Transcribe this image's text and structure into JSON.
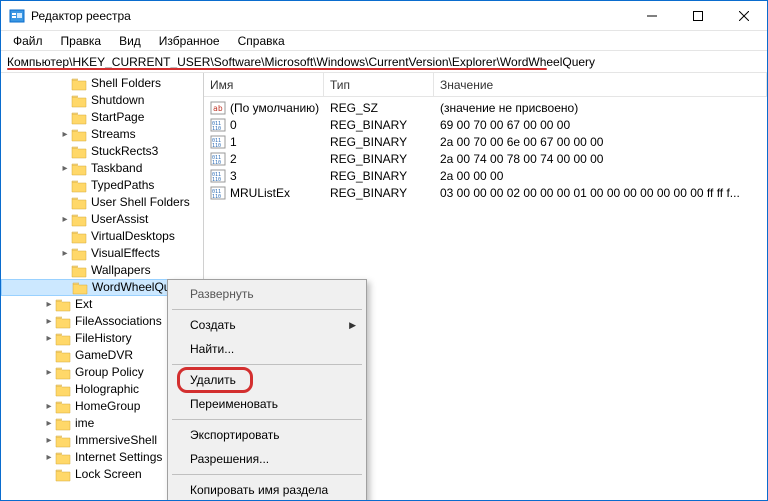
{
  "window": {
    "title": "Редактор реестра"
  },
  "menubar": [
    "Файл",
    "Правка",
    "Вид",
    "Избранное",
    "Справка"
  ],
  "address": "Компьютер\\HKEY_CURRENT_USER\\Software\\Microsoft\\Windows\\CurrentVersion\\Explorer\\WordWheelQuery",
  "tree": [
    {
      "label": "Shell Folders",
      "depth": 3,
      "exp": ""
    },
    {
      "label": "Shutdown",
      "depth": 3,
      "exp": ""
    },
    {
      "label": "StartPage",
      "depth": 3,
      "exp": ""
    },
    {
      "label": "Streams",
      "depth": 3,
      "exp": ">"
    },
    {
      "label": "StuckRects3",
      "depth": 3,
      "exp": ""
    },
    {
      "label": "Taskband",
      "depth": 3,
      "exp": ">"
    },
    {
      "label": "TypedPaths",
      "depth": 3,
      "exp": ""
    },
    {
      "label": "User Shell Folders",
      "depth": 3,
      "exp": ""
    },
    {
      "label": "UserAssist",
      "depth": 3,
      "exp": ">"
    },
    {
      "label": "VirtualDesktops",
      "depth": 3,
      "exp": ""
    },
    {
      "label": "VisualEffects",
      "depth": 3,
      "exp": ">"
    },
    {
      "label": "Wallpapers",
      "depth": 3,
      "exp": ""
    },
    {
      "label": "WordWheelQuery",
      "depth": 3,
      "exp": "",
      "selected": true
    },
    {
      "label": "Ext",
      "depth": 2,
      "exp": ">"
    },
    {
      "label": "FileAssociations",
      "depth": 2,
      "exp": ">"
    },
    {
      "label": "FileHistory",
      "depth": 2,
      "exp": ">"
    },
    {
      "label": "GameDVR",
      "depth": 2,
      "exp": ""
    },
    {
      "label": "Group Policy",
      "depth": 2,
      "exp": ">"
    },
    {
      "label": "Holographic",
      "depth": 2,
      "exp": ""
    },
    {
      "label": "HomeGroup",
      "depth": 2,
      "exp": ">"
    },
    {
      "label": "ime",
      "depth": 2,
      "exp": ">"
    },
    {
      "label": "ImmersiveShell",
      "depth": 2,
      "exp": ">"
    },
    {
      "label": "Internet Settings",
      "depth": 2,
      "exp": ">"
    },
    {
      "label": "Lock Screen",
      "depth": 2,
      "exp": ""
    }
  ],
  "columns": {
    "name": "Имя",
    "type": "Тип",
    "data": "Значение"
  },
  "values": [
    {
      "icon": "sz",
      "name": "(По умолчанию)",
      "type": "REG_SZ",
      "data": "(значение не присвоено)"
    },
    {
      "icon": "bin",
      "name": "0",
      "type": "REG_BINARY",
      "data": "69 00 70 00 67 00 00 00"
    },
    {
      "icon": "bin",
      "name": "1",
      "type": "REG_BINARY",
      "data": "2a 00 70 00 6e 00 67 00 00 00"
    },
    {
      "icon": "bin",
      "name": "2",
      "type": "REG_BINARY",
      "data": "2a 00 74 00 78 00 74 00 00 00"
    },
    {
      "icon": "bin",
      "name": "3",
      "type": "REG_BINARY",
      "data": "2a 00 00 00"
    },
    {
      "icon": "bin",
      "name": "MRUListEx",
      "type": "REG_BINARY",
      "data": "03 00 00 00 02 00 00 00 01 00 00 00 00 00 00 00 ff ff f..."
    }
  ],
  "context_menu": [
    {
      "label": "Развернуть",
      "enabled": false
    },
    {
      "sep": true
    },
    {
      "label": "Создать",
      "enabled": true,
      "submenu": true
    },
    {
      "label": "Найти...",
      "enabled": true
    },
    {
      "sep": true
    },
    {
      "label": "Удалить",
      "enabled": true,
      "highlight": true
    },
    {
      "label": "Переименовать",
      "enabled": true
    },
    {
      "sep": true
    },
    {
      "label": "Экспортировать",
      "enabled": true
    },
    {
      "label": "Разрешения...",
      "enabled": true
    },
    {
      "sep": true
    },
    {
      "label": "Копировать имя раздела",
      "enabled": true
    }
  ]
}
